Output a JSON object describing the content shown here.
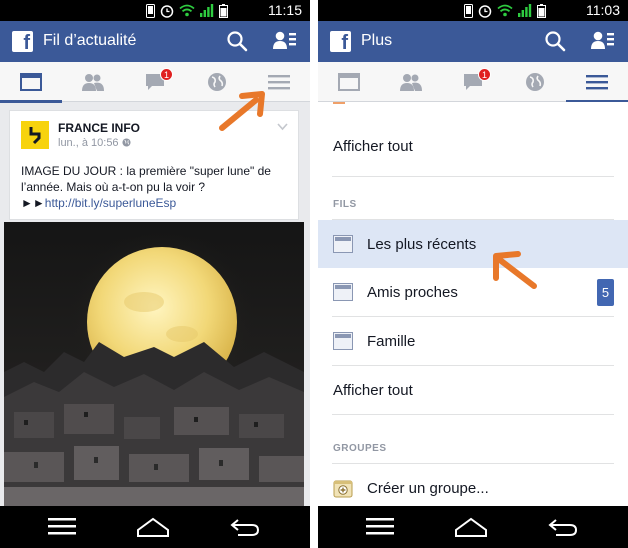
{
  "left": {
    "status": {
      "time": "11:15"
    },
    "appbar": {
      "title": "Fil d’actualité"
    },
    "tabs": {
      "messages_badge": "1",
      "active": "news-feed"
    },
    "post": {
      "author": "FRANCE INFO",
      "time": "lun., à 10:56",
      "time_icon": "globe-icon",
      "text": "IMAGE DU JOUR : la première \"super lune\" de l’année. Mais où a-t-on pu la voir ?",
      "link_prefix": "►►",
      "link": "http://bit.ly/superluneEsp"
    }
  },
  "right": {
    "status": {
      "time": "11:03"
    },
    "appbar": {
      "title": "Plus"
    },
    "tabs": {
      "messages_badge": "1",
      "active": "more"
    },
    "menu": {
      "show_all_top": "Afficher tout",
      "feeds_header": "FILS",
      "feeds": [
        {
          "label": "Les plus récents",
          "selected": true
        },
        {
          "label": "Amis proches",
          "count": "5"
        },
        {
          "label": "Famille"
        }
      ],
      "show_all_bottom": "Afficher tout",
      "groups_header": "GROUPES",
      "create_group": "Créer un groupe..."
    }
  },
  "colors": {
    "facebook_blue": "#3b5998",
    "arrow_orange": "#e8782a",
    "badge_red": "#e02020",
    "selected_row": "#dde6f5",
    "count_badge": "#4267b2"
  },
  "icons": {
    "appbar": [
      "search-icon",
      "friend-requests-icon"
    ],
    "tabs": [
      "news-feed-icon",
      "friends-icon",
      "messages-icon",
      "notifications-globe-icon",
      "menu-icon"
    ],
    "navbar": [
      "menu-icon",
      "home-icon",
      "back-icon"
    ]
  }
}
